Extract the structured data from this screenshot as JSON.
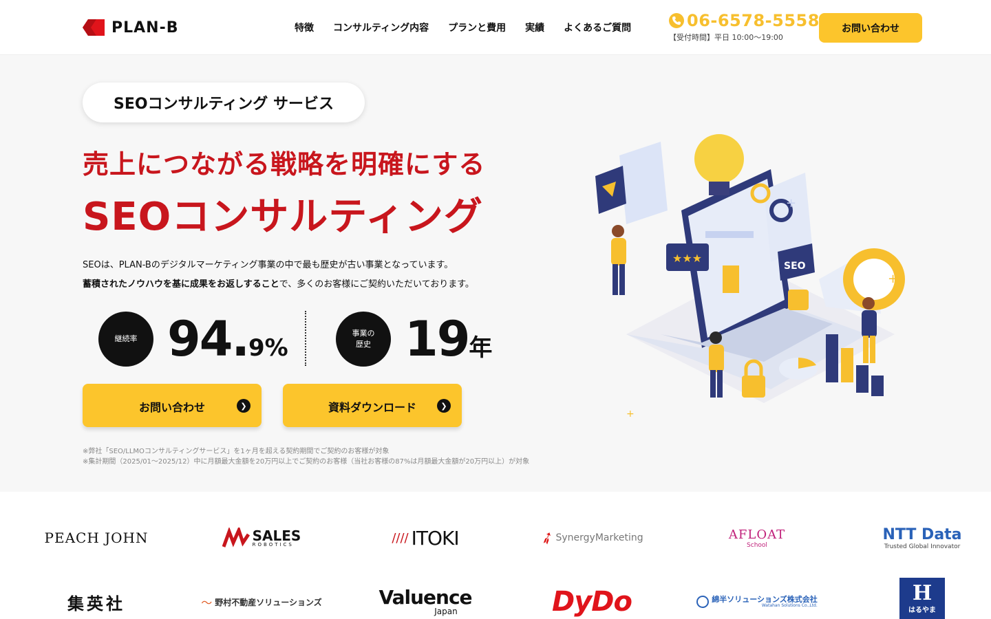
{
  "header": {
    "brand": "PLAN-B",
    "nav": [
      "特徴",
      "コンサルティング内容",
      "プランと費用",
      "実績",
      "よくあるご質問"
    ],
    "phone": "06-6578-5558",
    "hours": "【受付時間】平日 10:00〜19:00",
    "cta": "お問い合わせ"
  },
  "hero": {
    "pill": "SEOコンサルティング サービス",
    "headline1": "売上につながる戦略を明確にする",
    "headline2": "SEOコンサルティング",
    "desc_line1": "SEOは、PLAN-Bのデジタルマーケティング事業の中で最も歴史が古い事業となっています。",
    "desc_line2_bold": "蓄積されたノウハウを基に成果をお返しすること",
    "desc_line2_rest": "で、多くのお客様にご契約いただいております。",
    "stats": [
      {
        "label": "継続率",
        "value": "94.",
        "value_small": "9%"
      },
      {
        "label_line1": "事業の",
        "label_line2": "歴史",
        "value": "19",
        "value_small": "年"
      }
    ],
    "buttons": [
      "お問い合わせ",
      "資料ダウンロード"
    ],
    "notes": [
      "※弊社「SEO/LLMOコンサルティングサービス」を1ヶ月を超える契約期間でご契約のお客様が対象",
      "※集計期間（2025/01〜2025/12）中に月額最大金額を20万円以上でご契約のお客様（当社お客様の87%は月額最大金額が20万円以上）が対象"
    ]
  },
  "clients": [
    "PEACH JOHN",
    "SALES",
    "ROBOTICS",
    "ITOKI",
    "SynergyMarketing",
    "AFLOAT",
    "School",
    "NTT Data",
    "Trusted Global Innovator",
    "集英社",
    "野村不動産ソリューションズ",
    "Valuence",
    "Japan",
    "DyDo",
    "綿半ソリューションズ株式会社",
    "Watahan Solutions Co.,Ltd.",
    "はるやま"
  ],
  "colors": {
    "accent_red": "#c8161d",
    "accent_yellow": "#fcc52c",
    "phone_orange": "#f7bf2e"
  }
}
